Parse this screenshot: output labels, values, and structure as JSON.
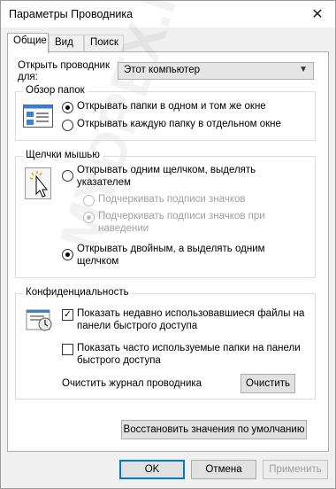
{
  "window": {
    "title": "Параметры Проводника",
    "close_glyph": "✕"
  },
  "tabs": [
    {
      "label": "Общие",
      "active": true
    },
    {
      "label": "Вид",
      "active": false
    },
    {
      "label": "Поиск",
      "active": false
    }
  ],
  "open_explorer": {
    "label_line1": "Открыть проводник",
    "label_line2": "для:",
    "value": "Этот компьютер"
  },
  "browse_folders": {
    "title": "Обзор папок",
    "option_same": "Открывать папки в одном и том же окне",
    "option_separate": "Открывать каждую папку в отдельном окне",
    "selected": "same"
  },
  "mouse_clicks": {
    "title": "Щелчки мышью",
    "single_line1": "Открывать одним щелчком, выделять",
    "single_line2": "указателем",
    "underline_always": "Подчеркивать подписи значков",
    "underline_hover_line1": "Подчеркивать подписи значков при",
    "underline_hover_line2": "наведении",
    "double_line1": "Открывать двойным, а выделять одним",
    "double_line2": "щелчком",
    "selected": "double"
  },
  "privacy": {
    "title": "Конфиденциальность",
    "recent_files_line1": "Показать недавно использовавшиеся файлы на",
    "recent_files_line2": "панели быстрого доступа",
    "recent_files_checked": true,
    "frequent_folders_line1": "Показать часто используемые папки на панели",
    "frequent_folders_line2": "быстрого доступа",
    "frequent_folders_checked": false,
    "clear_history_label": "Очистить журнал проводника",
    "clear_button": "Очистить"
  },
  "restore_defaults": "Восстановить значения по умолчанию",
  "footer": {
    "ok": "OK",
    "cancel": "Отмена",
    "apply": "Применить"
  },
  "watermark": "MYDREX.RU",
  "colors": {
    "accent": "#0078d7",
    "disabled": "#a0a0a0"
  }
}
